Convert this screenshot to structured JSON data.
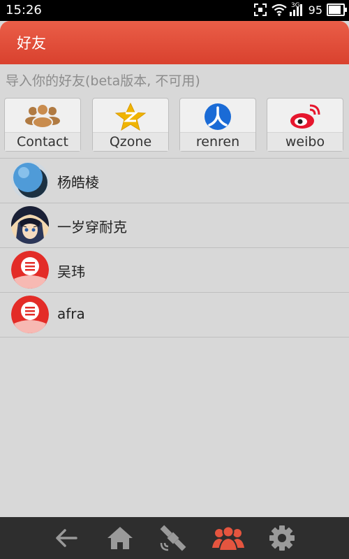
{
  "status_bar": {
    "time": "15:26",
    "network": "3G",
    "battery": "95",
    "battery_level": 0.95
  },
  "header": {
    "title": "好友"
  },
  "import": {
    "subtitle": "导入你的好友(beta版本, 不可用)"
  },
  "sources": [
    {
      "label": "Contact",
      "icon": "contact-icon"
    },
    {
      "label": "Qzone",
      "icon": "qzone-icon"
    },
    {
      "label": "renren",
      "icon": "renren-icon"
    },
    {
      "label": "weibo",
      "icon": "weibo-icon"
    }
  ],
  "friends": [
    {
      "name": "杨皓棱",
      "avatar": "blue-balloon"
    },
    {
      "name": "一岁穿耐克",
      "avatar": "anime-portrait"
    },
    {
      "name": "吴玮",
      "avatar": "default-red"
    },
    {
      "name": "afra",
      "avatar": "default-red"
    }
  ],
  "nav": [
    {
      "icon": "back-arrow-icon",
      "active": false
    },
    {
      "icon": "home-icon",
      "active": false
    },
    {
      "icon": "satellite-icon",
      "active": false
    },
    {
      "icon": "friends-icon",
      "active": true
    },
    {
      "icon": "gear-icon",
      "active": false
    }
  ],
  "colors": {
    "accent": "#e04e39",
    "nav_bg": "#2e2e2e",
    "nav_icon": "#9a9a9a",
    "nav_active": "#e5553f"
  }
}
